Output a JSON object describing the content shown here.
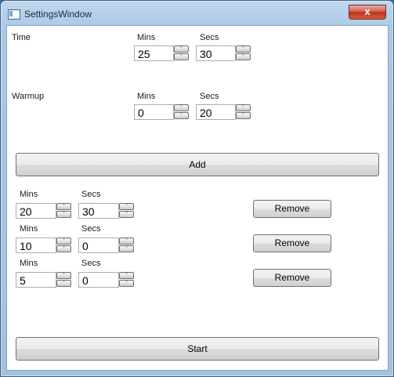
{
  "window": {
    "title": "SettingsWindow",
    "close_glyph": "x"
  },
  "time": {
    "label": "Time",
    "mins_label": "Mins",
    "secs_label": "Secs",
    "mins": "25",
    "secs": "30"
  },
  "warmup": {
    "label": "Warmup",
    "mins_label": "Mins",
    "secs_label": "Secs",
    "mins": "0",
    "secs": "20"
  },
  "add_label": "Add",
  "intervals": [
    {
      "mins_label": "Mins",
      "secs_label": "Secs",
      "mins": "20",
      "secs": "30",
      "remove_label": "Remove"
    },
    {
      "mins_label": "Mins",
      "secs_label": "Secs",
      "mins": "10",
      "secs": "0",
      "remove_label": "Remove"
    },
    {
      "mins_label": "Mins",
      "secs_label": "Secs",
      "mins": "5",
      "secs": "0",
      "remove_label": "Remove"
    }
  ],
  "start_label": "Start",
  "spinner_icons": {
    "up": "chevron-up-icon",
    "down": "chevron-down-icon"
  }
}
